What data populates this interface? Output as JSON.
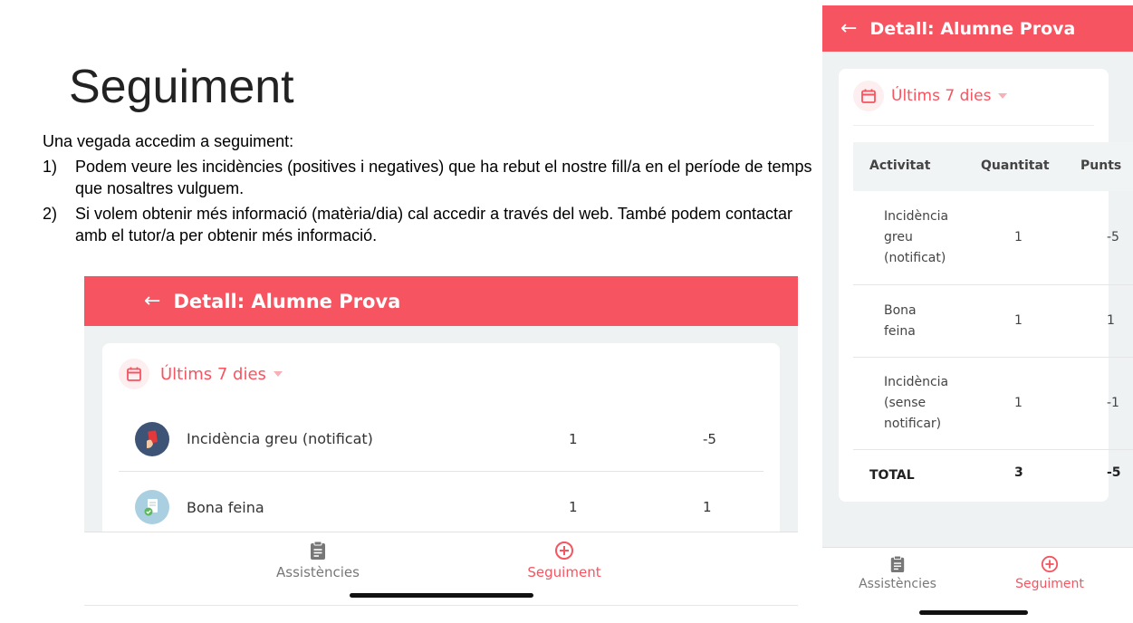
{
  "slide": {
    "title": "Seguiment",
    "intro": "Una vegada accedim a seguiment:",
    "points": [
      {
        "num": "1)",
        "text": "Podem veure les incidències (positives i negatives) que ha rebut el nostre fill/a en el període de temps que nosaltres vulguem."
      },
      {
        "num": "2)",
        "text": "Si volem obtenir més informació (matèria/dia) cal accedir a través del web. També podem contactar amb el tutor/a per obtenir més informació."
      }
    ]
  },
  "app": {
    "header_title": "Detall: Alumne Prova",
    "period_label": "Últims 7 dies",
    "tabs": {
      "assistencies": "Assistències",
      "seguiment": "Seguiment"
    },
    "colors": {
      "accent": "#f55460",
      "background": "#eef2f3"
    }
  },
  "left_list": [
    {
      "name": "Incidència greu (notificat)",
      "qty": "1",
      "pts": "-5",
      "icon": "red-card-icon"
    },
    {
      "name": "Bona feina",
      "qty": "1",
      "pts": "1",
      "icon": "document-check-icon"
    }
  ],
  "right_table": {
    "headers": {
      "activitat": "Activitat",
      "quantitat": "Quantitat",
      "punts": "Punts"
    },
    "rows": [
      {
        "line1": "Incidència",
        "line2": "greu",
        "line3": "(notificat)",
        "qty": "1",
        "pts": "-5"
      },
      {
        "line1": "Bona",
        "line2": "feina",
        "qty": "1",
        "pts": "1"
      },
      {
        "line1": "Incidència",
        "line2": "(sense",
        "line3": "notificar)",
        "qty": "1",
        "pts": "-1"
      }
    ],
    "total": {
      "label": "TOTAL",
      "qty": "3",
      "pts": "-5"
    }
  }
}
